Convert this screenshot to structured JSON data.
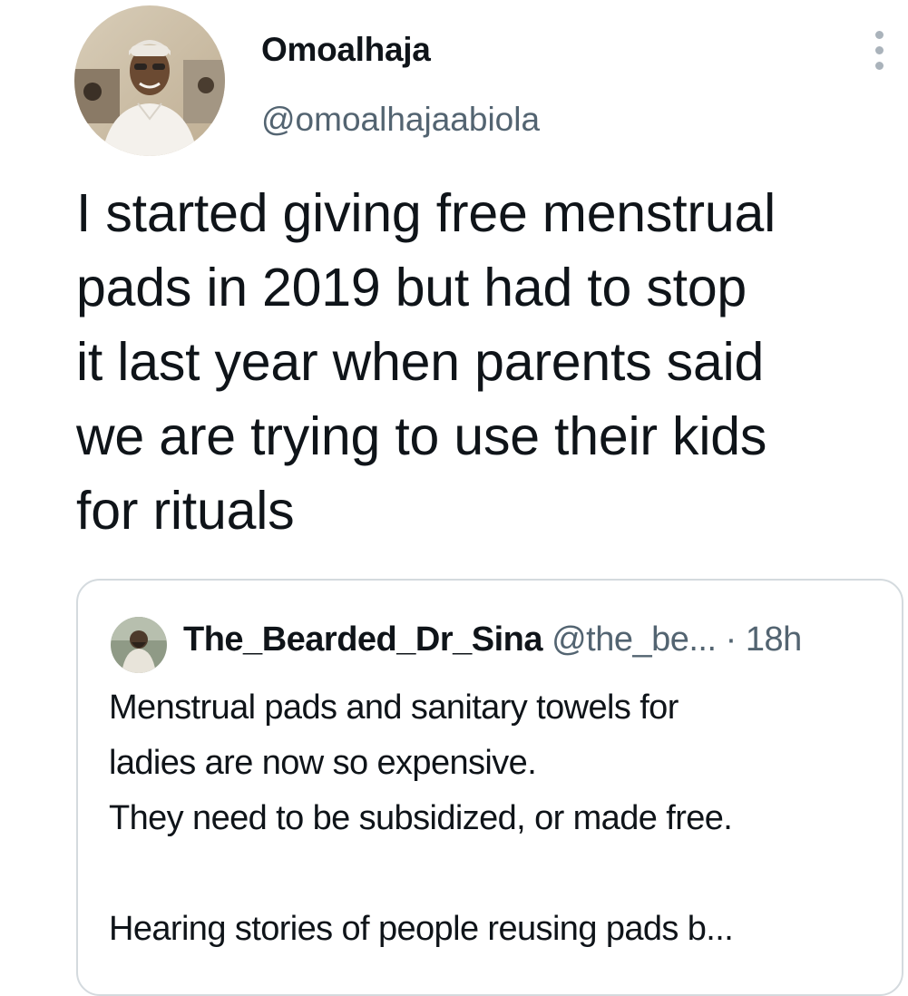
{
  "author": {
    "display_name": "Omoalhaja",
    "handle": "@omoalhajaabiola",
    "avatar_icon": "profile-photo"
  },
  "menu_icon": "more-vertical-icon",
  "tweet": {
    "text": "I started giving free menstrual\npads in 2019 but had to stop\nit last year when parents said\nwe are trying to use their kids\nfor rituals"
  },
  "quoted_tweet": {
    "display_name": "The_Bearded_Dr_Sina",
    "handle": "@the_be...",
    "separator": "·",
    "time": "18h",
    "avatar_icon": "profile-photo",
    "text": "Menstrual pads and sanitary towels for\nladies are now so expensive.\nThey need to be subsidized, or made free.\n\nHearing stories of people reusing pads b..."
  },
  "colors": {
    "text_primary": "#0f1419",
    "text_secondary": "#536471",
    "border": "#d4dade",
    "background": "#ffffff"
  }
}
